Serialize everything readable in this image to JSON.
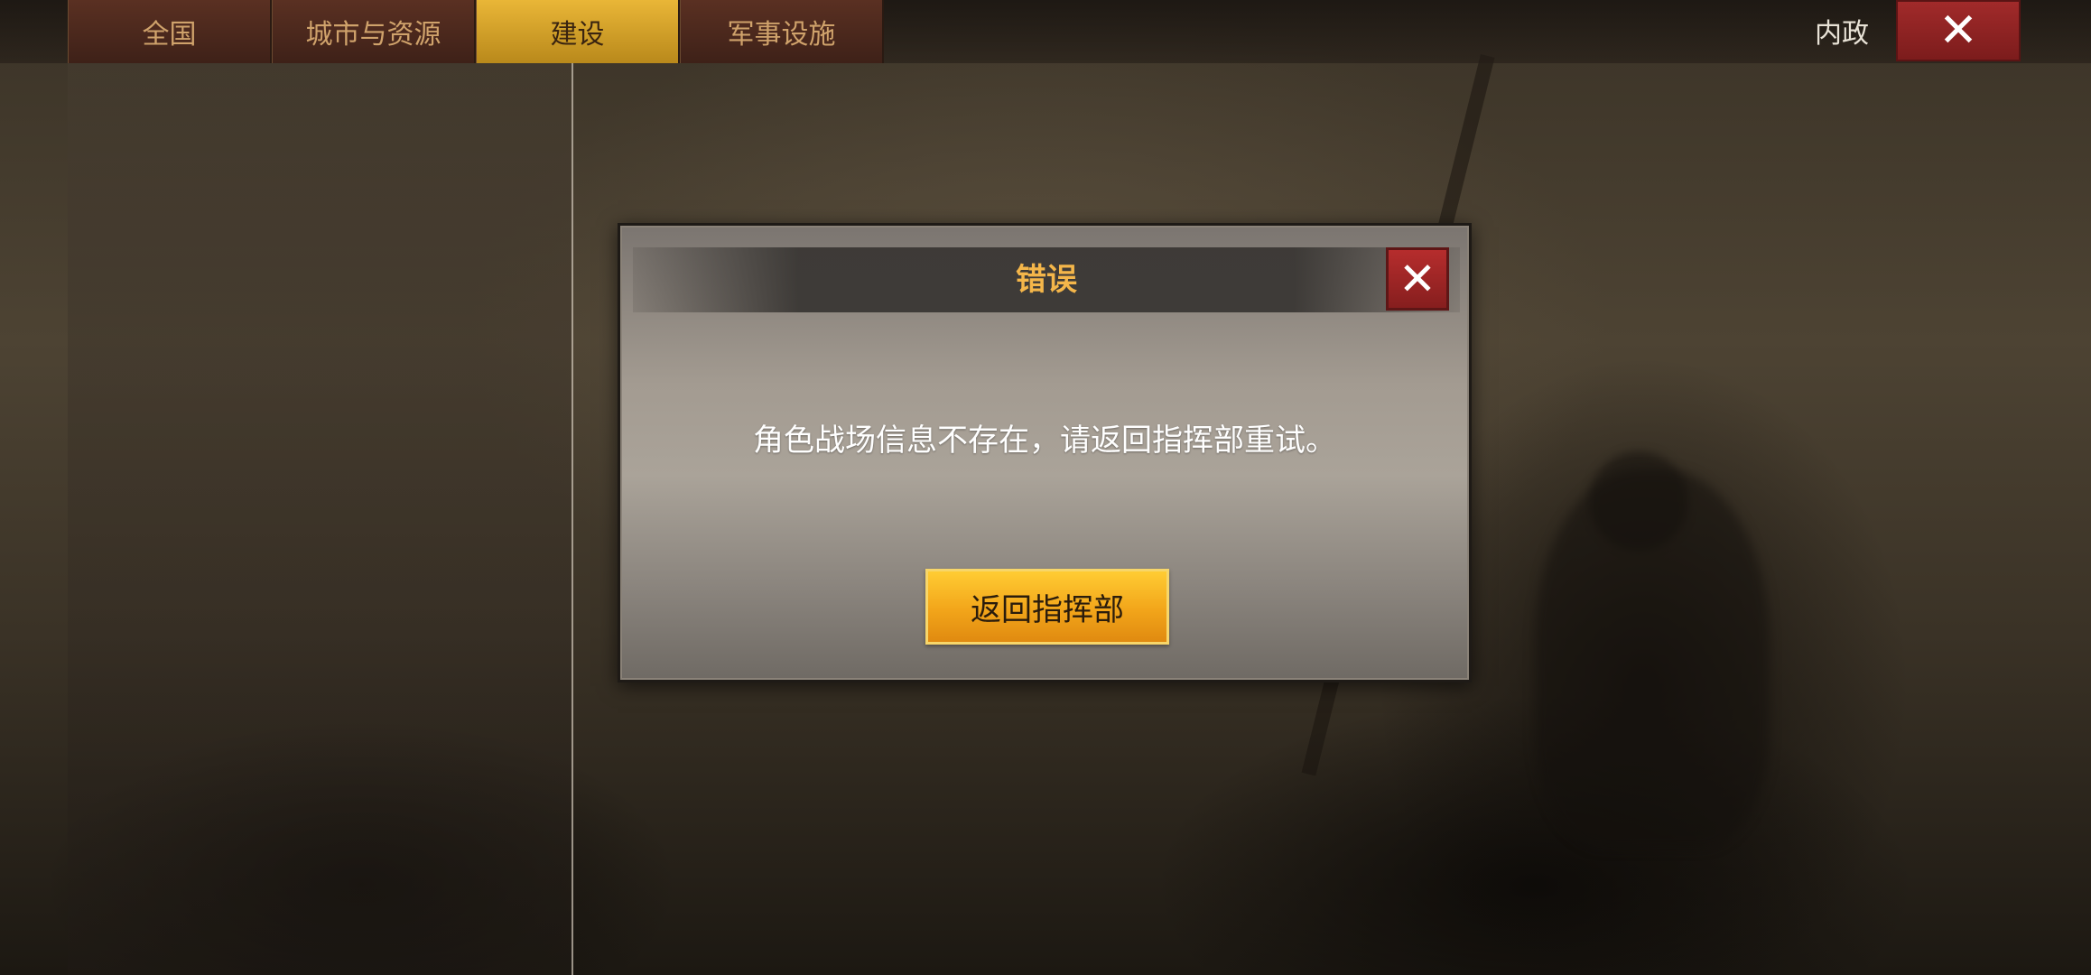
{
  "top_bar": {
    "tabs": [
      {
        "label": "全国",
        "active": false
      },
      {
        "label": "城市与资源",
        "active": false
      },
      {
        "label": "建设",
        "active": true
      },
      {
        "label": "军事设施",
        "active": false
      }
    ],
    "section_label": "内政",
    "close_icon": "close-icon"
  },
  "dialog": {
    "title": "错误",
    "message": "角色战场信息不存在，请返回指挥部重试。",
    "button_label": "返回指挥部",
    "close_icon": "close-icon"
  },
  "colors": {
    "active_tab": "#e9b637",
    "inactive_tab": "#4a2a1e",
    "dialog_title": "#f4b64a",
    "close_button": "#a12a2a",
    "primary_button": "#f2a51a"
  }
}
